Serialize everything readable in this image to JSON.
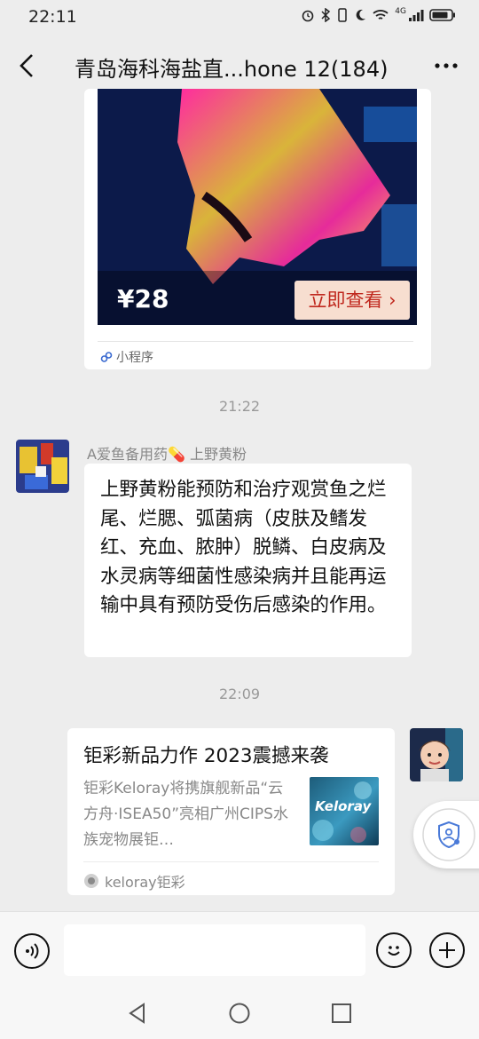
{
  "status_bar": {
    "time": "22:11",
    "network": "4G",
    "icons": [
      "alarm-icon",
      "bluetooth-icon",
      "vibrate-icon",
      "moon-icon",
      "wifi-icon",
      "signal-icon",
      "battery-icon"
    ]
  },
  "header": {
    "title": "青岛海科海盐直...hone 12(184)",
    "back_icon": "chevron-left-icon",
    "more_icon": "more-icon"
  },
  "messages": {
    "mini_program": {
      "price": "¥28",
      "view_button": "立即查看",
      "tag": "小程序"
    },
    "time1": "21:22",
    "text_message": {
      "sender": "A爱鱼备用药💊 上野黄粉",
      "text": "上野黄粉能预防和治疗观赏鱼之烂尾、烂腮、弧菌病（皮肤及鳍发红、充血、脓肿）脱鳞、白皮病及水灵病等细菌性感染病并且能再运输中具有预防受伤后感染的作用。"
    },
    "time2": "22:09",
    "link_card": {
      "title": "钜彩新品力作 2023震撼来袭",
      "description": "钜彩Keloray将携旗舰新品“云方舟·ISEA50”亮相广州CIPS水族宠物展钜…",
      "thumb_text": "Keloray",
      "source": "keloray钜彩"
    }
  },
  "input_bar": {
    "placeholder": ""
  },
  "colors": {
    "background": "#ededed",
    "bubble": "#ffffff",
    "accent_red": "#c0281e"
  }
}
